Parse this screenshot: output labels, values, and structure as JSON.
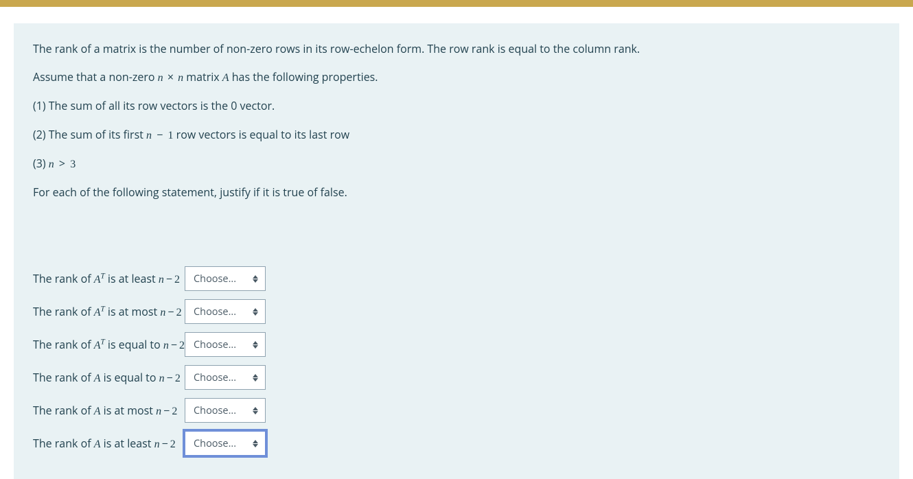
{
  "colors": {
    "accent_bar": "#c9a74e",
    "panel_bg": "#e9f2f4",
    "text": "#22424f",
    "focus_ring": "#6f8fd8"
  },
  "intro": {
    "line1": "The rank of a matrix is the number of non-zero rows in its row-echelon form. The row rank is equal to the column rank.",
    "line2_pre": "Assume that a non-zero ",
    "line2_mid": " matrix ",
    "line2_post": " has the following properties.",
    "prop1": "(1) The sum of all its row vectors  is the 0 vector.",
    "prop2_pre": "(2) The sum of its first ",
    "prop2_post": " row vectors is equal to its last row",
    "prop3_pre": "(3) ",
    "instruction": "For each of the following statement, justify if it is true of false."
  },
  "math": {
    "n": "n",
    "A": "A",
    "AT_T": "T",
    "times": "×",
    "one": "1",
    "two": "2",
    "three": "3",
    "gt": ">",
    "minus": "−"
  },
  "select": {
    "placeholder": "Choose..."
  },
  "statements": [
    {
      "pre": "The rank of ",
      "sym": "AT",
      "mid": " is at least ",
      "tail": "n-2",
      "focused": false
    },
    {
      "pre": "The rank of ",
      "sym": "AT",
      "mid": " is at most ",
      "tail": "n-2",
      "focused": false
    },
    {
      "pre": "The rank of ",
      "sym": "AT",
      "mid": " is equal to ",
      "tail": "n-2",
      "focused": false
    },
    {
      "pre": "The rank of ",
      "sym": "A",
      "mid": " is equal to  ",
      "tail": "n-2",
      "focused": false
    },
    {
      "pre": "The rank of ",
      "sym": "A",
      "mid": " is at most ",
      "tail": "n-2",
      "focused": false
    },
    {
      "pre": "The rank of ",
      "sym": "A",
      "mid": " is at least ",
      "tail": "n-2",
      "focused": true
    }
  ]
}
